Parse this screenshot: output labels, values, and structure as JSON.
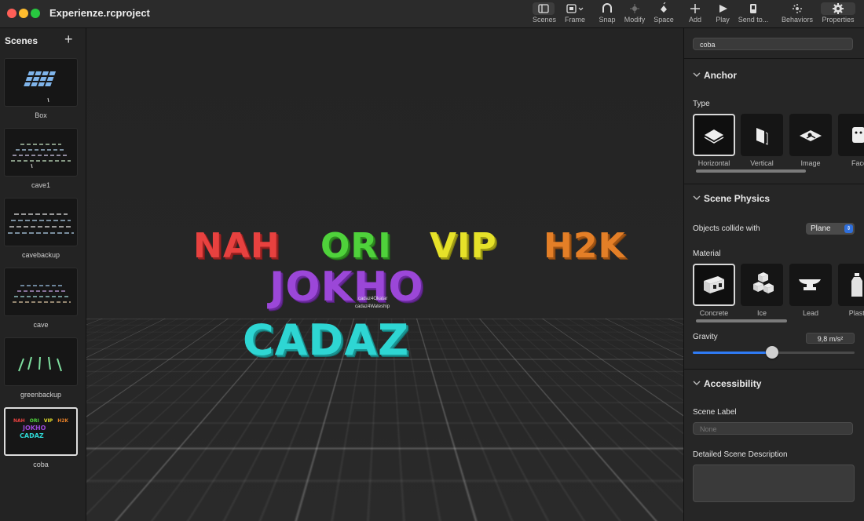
{
  "window": {
    "title": "Experienze.rcproject"
  },
  "toolbar": {
    "items": [
      {
        "label": "Scenes",
        "icon": "sidebar-icon"
      },
      {
        "label": "Frame",
        "icon": "frame-icon"
      },
      {
        "label": "Snap",
        "icon": "magnet-icon"
      },
      {
        "label": "Modify",
        "icon": "modify-icon"
      },
      {
        "label": "Space",
        "icon": "space-icon"
      },
      {
        "label": "Add",
        "icon": "plus-icon"
      },
      {
        "label": "Play",
        "icon": "play-icon"
      },
      {
        "label": "Send to...",
        "icon": "send-icon"
      },
      {
        "label": "Behaviors",
        "icon": "behaviors-icon"
      },
      {
        "label": "Properties",
        "icon": "gear-icon"
      }
    ]
  },
  "scenes_panel": {
    "title": "Scenes",
    "add_label": "+",
    "items": [
      {
        "name": "Box"
      },
      {
        "name": "cave1"
      },
      {
        "name": "cavebackup"
      },
      {
        "name": "cave"
      },
      {
        "name": "greenbackup"
      },
      {
        "name": "coba",
        "selected": true
      }
    ],
    "coba_thumb": {
      "w1": "NAH",
      "w2": "ORI",
      "w3": "VIP",
      "w4": "H2K",
      "w5": "JOKHO",
      "w6": "CADAZ"
    }
  },
  "viewport": {
    "words": [
      {
        "text": "NAH",
        "color": "#e8413f"
      },
      {
        "text": "ORI",
        "color": "#4fd23b"
      },
      {
        "text": "VIP",
        "color": "#e6e229"
      },
      {
        "text": "H2K",
        "color": "#e47f27"
      },
      {
        "text": "JOKHO",
        "color": "#9b47d8"
      },
      {
        "text": "CADAZ",
        "color": "#2ed6d3"
      }
    ],
    "small_labels": [
      "cadaz4Okatar",
      "cadaz4Wateship"
    ]
  },
  "properties": {
    "scene_name": "coba",
    "anchor": {
      "header": "Anchor",
      "type_label": "Type",
      "types": [
        {
          "label": "Horizontal",
          "selected": true
        },
        {
          "label": "Vertical"
        },
        {
          "label": "Image"
        },
        {
          "label": "Face"
        }
      ]
    },
    "physics": {
      "header": "Scene Physics",
      "collide_label": "Objects collide with",
      "collide_value": "Plane",
      "material_label": "Material",
      "materials": [
        {
          "label": "Concrete",
          "selected": true
        },
        {
          "label": "Ice"
        },
        {
          "label": "Lead"
        },
        {
          "label": "Plastic"
        }
      ],
      "gravity_label": "Gravity",
      "gravity_value": "9,8 m/s²",
      "gravity_level": 0.49
    },
    "accessibility": {
      "header": "Accessibility",
      "scene_label_title": "Scene Label",
      "scene_label_placeholder": "None",
      "description_title": "Detailed Scene Description"
    }
  },
  "colors": {
    "accent": "#2f7bf5",
    "selection_border": "#d8d8d8"
  }
}
